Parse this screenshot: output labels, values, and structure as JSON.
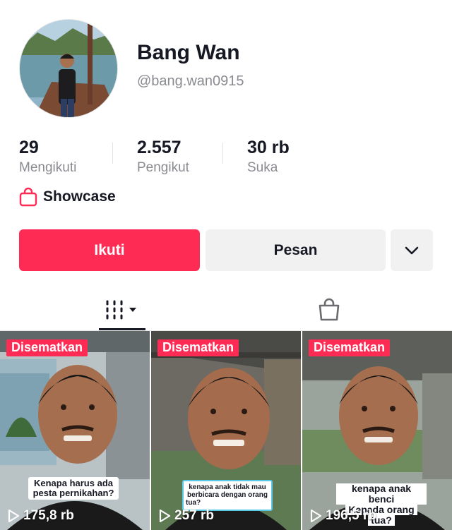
{
  "profile": {
    "display_name": "Bang Wan",
    "username": "@bang.wan0915",
    "avatar_icon": "profile-photo"
  },
  "stats": {
    "following": {
      "value": "29",
      "label": "Mengikuti"
    },
    "followers": {
      "value": "2.557",
      "label": "Pengikut"
    },
    "likes": {
      "value": "30 rb",
      "label": "Suka"
    }
  },
  "showcase": {
    "label": "Showcase",
    "icon": "shopping-bag-icon"
  },
  "actions": {
    "follow_label": "Ikuti",
    "message_label": "Pesan",
    "more_icon": "chevron-down-icon"
  },
  "tabs": {
    "videos_icon": "video-grid-icon",
    "shop_icon": "shopping-bag-icon"
  },
  "videos": [
    {
      "badge": "Disematkan",
      "caption": [
        "Kenapa harus ada",
        "pesta pernikahan?"
      ],
      "views": "175,8 rb"
    },
    {
      "badge": "Disematkan",
      "caption": [
        "kenapa anak tidak mau",
        "berbicara dengan orang",
        "tua?"
      ],
      "views": "257 rb"
    },
    {
      "badge": "Disematkan",
      "caption": [
        "kenapa anak benci",
        "Kepada orang",
        "tua?"
      ],
      "views": "196,5 rb"
    }
  ],
  "colors": {
    "accent": "#fe2c55",
    "text_primary": "#161823",
    "text_secondary": "#8a8b91",
    "button_secondary_bg": "#f1f1f2"
  }
}
